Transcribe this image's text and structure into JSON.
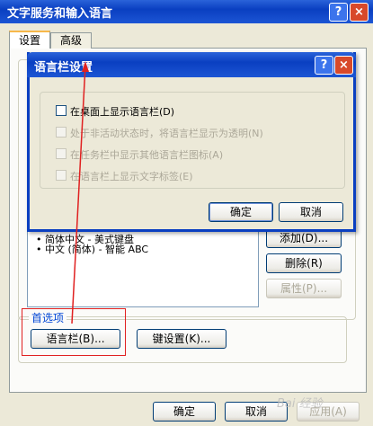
{
  "window": {
    "title": "文字服务和输入语言",
    "help_label": "?",
    "close_label": "×"
  },
  "tabs": [
    {
      "label": "设置"
    },
    {
      "label": "高级"
    }
  ],
  "installed_list": [
    "简体中文 - 美式键盘",
    "中文 (简体) - 智能 ABC"
  ],
  "side_buttons": {
    "add": "添加(D)...",
    "delete": "删除(R)",
    "properties": "属性(P)..."
  },
  "preferences": {
    "label": "首选项",
    "langbar_button": "语言栏(B)...",
    "key_settings_button": "键设置(K)..."
  },
  "footer": {
    "ok": "确定",
    "cancel": "取消",
    "apply": "应用(A)"
  },
  "dialog": {
    "title": "语言栏设置",
    "help_label": "?",
    "close_label": "×",
    "options": [
      {
        "label": "在桌面上显示语言栏(D)",
        "checked": false,
        "enabled": true
      },
      {
        "label": "处于非活动状态时，将语言栏显示为透明(N)",
        "checked": false,
        "enabled": false
      },
      {
        "label": "在任务栏中显示其他语言栏图标(A)",
        "checked": false,
        "enabled": false
      },
      {
        "label": "在语言栏上显示文字标签(E)",
        "checked": false,
        "enabled": false
      }
    ],
    "ok": "确定",
    "cancel": "取消"
  },
  "watermark": "Bai 经验",
  "colors": {
    "titlebar": "#0A3FC1",
    "highlight": "#E02020",
    "window_bg": "#ECE9D8"
  }
}
